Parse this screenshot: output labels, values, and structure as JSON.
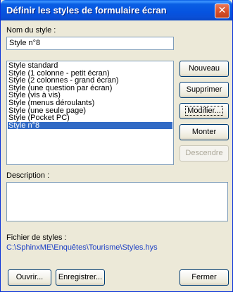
{
  "window": {
    "title": "Définir les styles de formulaire écran",
    "close_glyph": "✕"
  },
  "style_name": {
    "label": "Nom du style :",
    "value": "Style n°8"
  },
  "styles_list": {
    "items": [
      "Style standard",
      "Style (1 colonne - petit écran)",
      "Style (2 colonnes - grand écran)",
      "Style (une question par écran)",
      "Style (vis à vis)",
      "Style (menus déroulants)",
      "Style (une seule page)",
      "Style (Pocket PC)",
      "Style n°8"
    ],
    "selected": "Style n°8"
  },
  "side_buttons": {
    "nouveau": "Nouveau",
    "supprimer": "Supprimer",
    "modifier": "Modifier...",
    "monter": "Monter",
    "descendre": "Descendre"
  },
  "description": {
    "label": "Description :",
    "value": ""
  },
  "styles_file": {
    "label": "Fichier de styles :",
    "path": "C:\\SphinxME\\Enquêtes\\Tourisme\\Styles.hys"
  },
  "bottom_buttons": {
    "ouvrir": "Ouvrir...",
    "enregistrer": "Enregistrer...",
    "fermer": "Fermer"
  },
  "colors": {
    "title_bar": "#0a5fe4",
    "selection": "#316ac5",
    "path_text": "#1c3fc4",
    "dialog_bg": "#ece9d8"
  },
  "icons": {
    "close": "close-icon"
  }
}
